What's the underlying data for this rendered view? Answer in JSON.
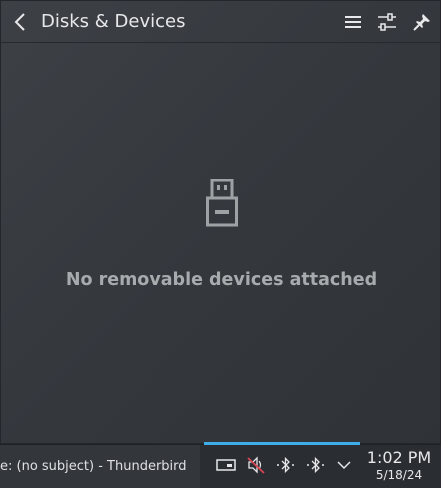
{
  "popup": {
    "title": "Disks & Devices",
    "empty_message": "No removable devices attached",
    "icons": {
      "back": "chevron-left-icon",
      "menu": "hamburger-menu-icon",
      "configure": "sliders-icon",
      "pin": "pin-icon",
      "empty": "usb-drive-icon"
    }
  },
  "taskbar": {
    "active_task": "e: (no subject) - Thunderbird",
    "tray_icons": [
      "disks-icon",
      "audio-muted-icon",
      "bluetooth-icon",
      "bluetooth-icon",
      "chevron-down-icon"
    ],
    "clock": {
      "time": "1:02 PM",
      "date": "5/18/24"
    },
    "accent_color": "#3daee9"
  }
}
